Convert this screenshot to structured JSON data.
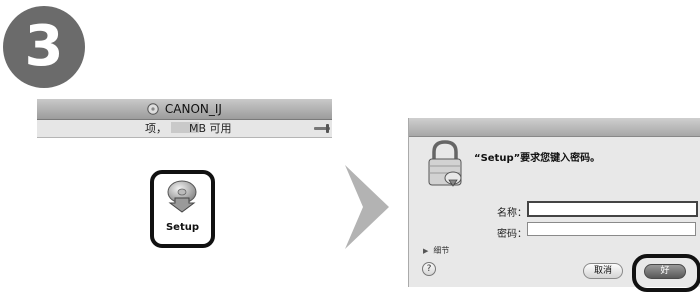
{
  "step": {
    "number": "3"
  },
  "finder": {
    "title": "CANON_IJ",
    "status_items": "项，",
    "status_mb": "MB 可用"
  },
  "setup_icon": {
    "label": "Setup"
  },
  "dialog": {
    "prompt": "“Setup”要求您键入密码。",
    "name_label": "名称：",
    "name_value": "",
    "password_label": "密码：",
    "password_value": "",
    "details_label": "细节",
    "help_label": "?",
    "cancel_label": "取消",
    "ok_label": "好"
  },
  "icons": {
    "disk": "disk-icon",
    "setup": "installer-disc-icon",
    "arrow": "next-arrow-icon",
    "lock": "lock-icon",
    "details": "disclosure-triangle-icon"
  },
  "colors": {
    "badge": "#6b6b6b",
    "arrow": "#b3b3b3",
    "highlight": "#111111"
  }
}
